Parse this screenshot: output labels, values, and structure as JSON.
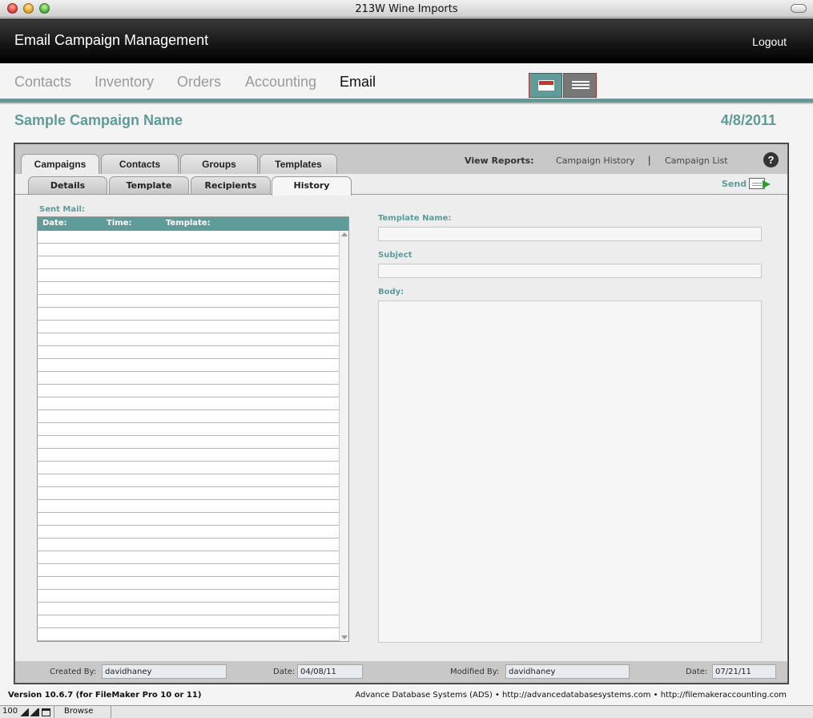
{
  "window": {
    "title": "213W Wine Imports"
  },
  "header": {
    "title": "Email Campaign Management",
    "logout": "Logout"
  },
  "nav": {
    "items": [
      "Contacts",
      "Inventory",
      "Orders",
      "Accounting",
      "Email"
    ],
    "active": "Email"
  },
  "view_toggle": {
    "form_icon": "form-view-icon",
    "list_icon": "list-view-icon"
  },
  "campaign": {
    "name": "Sample Campaign Name",
    "date": "4/8/2011"
  },
  "main_tabs": [
    "Campaigns",
    "Contacts",
    "Groups",
    "Templates"
  ],
  "reports": {
    "label": "View Reports:",
    "links": [
      "Campaign History",
      "Campaign List"
    ],
    "separator": "|"
  },
  "help": {
    "glyph": "?"
  },
  "sub_tabs": [
    "Details",
    "Template",
    "Recipients",
    "History"
  ],
  "send": {
    "label": "Send",
    "icon": "send-email-icon"
  },
  "sent_mail": {
    "label": "Sent Mail:",
    "columns": [
      "Date:",
      "Time:",
      "Template:"
    ],
    "rows": []
  },
  "detail": {
    "template_name_label": "Template Name:",
    "template_name": "",
    "subject_label": "Subject",
    "subject": "",
    "body_label": "Body:",
    "body": ""
  },
  "footer": {
    "created_by_label": "Created By:",
    "created_by": "davidhaney",
    "created_date_label": "Date:",
    "created_date": "04/08/11",
    "modified_by_label": "Modified By:",
    "modified_by": "davidhaney",
    "modified_date_label": "Date:",
    "modified_date": "07/21/11"
  },
  "bottom": {
    "version": "Version 10.6.7 (for FileMaker Pro 10 or 11)",
    "credits": "Advance Database Systems (ADS) • http://advancedatabasesystems.com • http://filemakeraccounting.com"
  },
  "statusbar": {
    "zoom": "100",
    "mode": "Browse"
  },
  "colors": {
    "accent": "#5f9b98",
    "header_bg": "#151515",
    "panel_bg": "#ededed"
  }
}
